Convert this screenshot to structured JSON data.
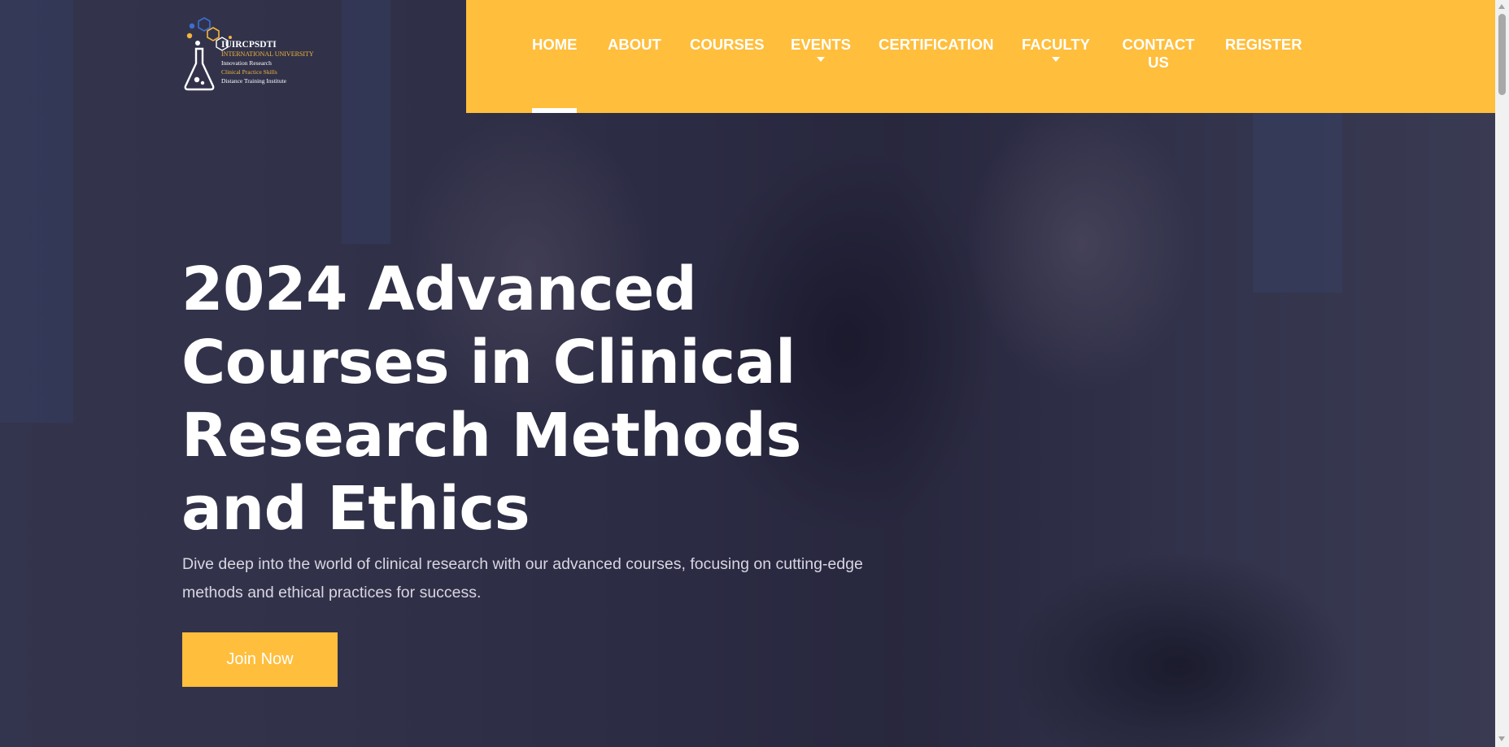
{
  "logo": {
    "name": "IUIRCPSDTI",
    "line2": "INTERNATIONAL UNIVERSITY",
    "line3": "Innovation Research",
    "line4": "Clinical Practice Skills",
    "line5": "Distance Training Institute",
    "icon": "flask-molecule-icon"
  },
  "nav": {
    "items": [
      {
        "label": "HOME",
        "active": true
      },
      {
        "label": "ABOUT"
      },
      {
        "label": "COURSES"
      },
      {
        "label": "EVENTS",
        "dropdown": true
      },
      {
        "label": "CERTIFICATION"
      },
      {
        "label": "FACULTY",
        "dropdown": true
      },
      {
        "label": "CONTACT US"
      },
      {
        "label": "REGISTER"
      }
    ]
  },
  "hero": {
    "title": "2024 Advanced Courses in Clinical Research Methods and Ethics",
    "subtitle": "Dive deep into the world of clinical research with our advanced courses, focusing on cutting-edge methods and ethical practices for success.",
    "cta_label": "Join Now"
  },
  "colors": {
    "accent": "#ffbe3c",
    "hero_overlay": "#2e2d45",
    "text": "#ffffff"
  }
}
